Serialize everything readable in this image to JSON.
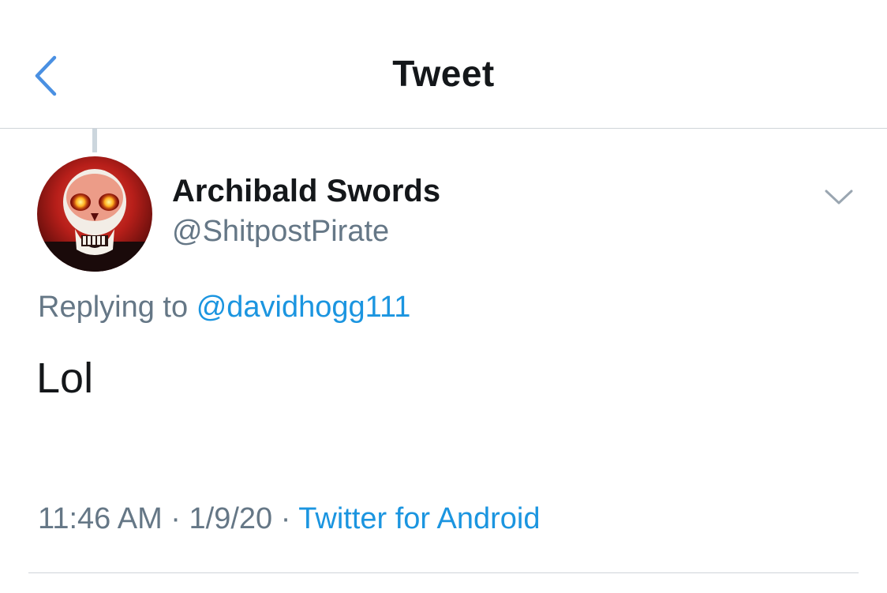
{
  "nav": {
    "title": "Tweet",
    "back_icon": "chevron-left-icon"
  },
  "tweet": {
    "author": {
      "display_name": "Archibald Swords",
      "handle": "@ShitpostPirate",
      "avatar": "skull-with-glowing-eyes"
    },
    "caret_icon": "chevron-down-icon",
    "replying_to_label": "Replying to",
    "replying_to_handle": "@davidhogg111",
    "text": "Lol",
    "time": "11:46 AM",
    "separator": "·",
    "date": "1/9/20",
    "source": "Twitter for Android"
  },
  "colors": {
    "accent": "#1b95e0",
    "secondary_text": "#657786",
    "primary_text": "#14171a",
    "divider": "#cfd4d9"
  }
}
